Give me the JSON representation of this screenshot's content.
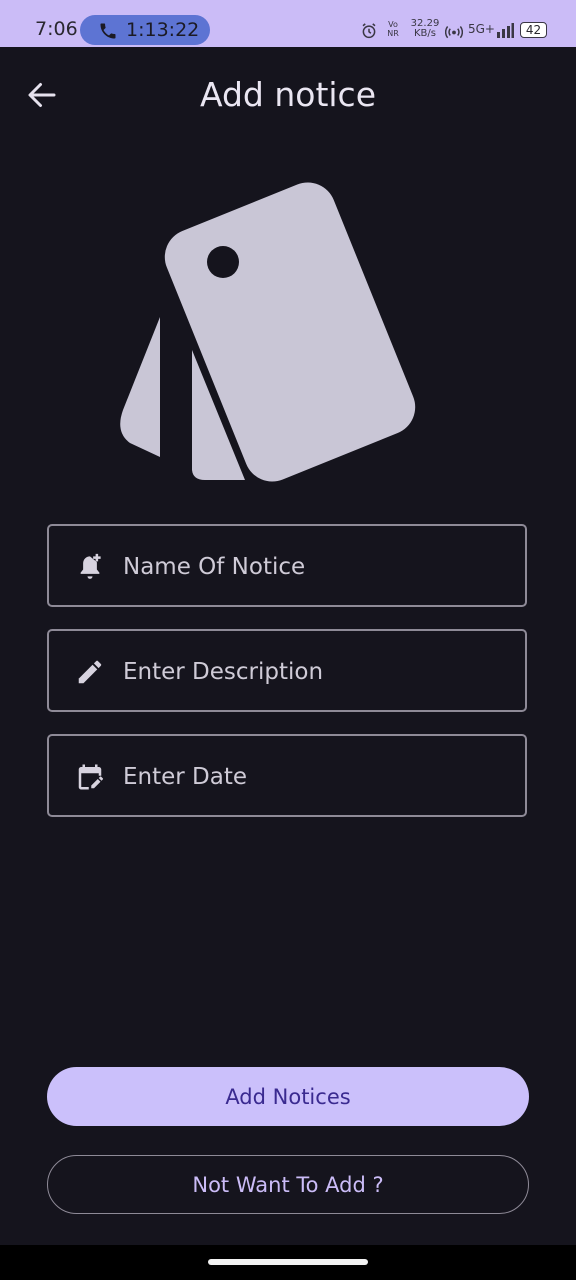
{
  "status_bar": {
    "time": "7:06",
    "call_timer": "1:13:22",
    "net_speed_value": "32.29",
    "net_speed_unit": "KB/s",
    "network_label": "5G+",
    "vo_label": "Vo",
    "nr_label": "NR",
    "battery": "42"
  },
  "header": {
    "title": "Add notice"
  },
  "form": {
    "name_placeholder": "Name Of Notice",
    "description_placeholder": "Enter Description",
    "date_placeholder": "Enter Date"
  },
  "actions": {
    "add_label": "Add Notices",
    "cancel_label": "Not Want To Add ?"
  },
  "colors": {
    "background": "#15141d",
    "status_bar": "#cbbcf7",
    "primary": "#cbc0fb",
    "on_primary": "#3a2a90",
    "outline": "#8e8a97",
    "illustration": "#c9c6d6"
  }
}
